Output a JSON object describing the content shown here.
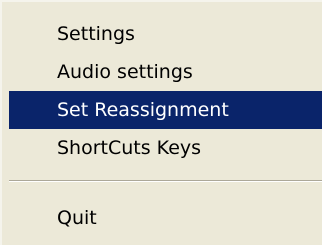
{
  "menu": {
    "items": [
      {
        "label": "Settings"
      },
      {
        "label": "Audio settings"
      },
      {
        "label": "Set Reassignment",
        "selected": true
      },
      {
        "label": "ShortCuts Keys"
      },
      {
        "label": "Quit"
      }
    ]
  },
  "colors": {
    "menu_background": "#ece9d8",
    "selection_background": "#0a246a",
    "selection_text": "#ffffff",
    "text": "#000000"
  }
}
